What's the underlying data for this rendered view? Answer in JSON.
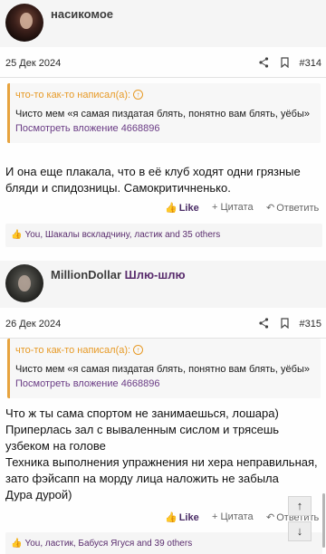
{
  "posts": [
    {
      "author": "насикомое",
      "author_link": "",
      "date": "25 Дек 2024",
      "number": "#314",
      "quote_header": "что-то как-то написал(а):",
      "quote_text": "Чисто мем «я самая пиздатая блять, понятно вам блять, уёбы»",
      "quote_link": "Посмотреть вложение 4668896",
      "body": [
        "И она еще плакала, что в её клуб ходят одни грязные",
        "бляди и спидозницы. Самокритичненько."
      ],
      "like_label": "Like",
      "quote_label": "+ Цитата",
      "reply_label": "Ответить",
      "likes_text": "You, Шакалы вскладчину, ластик and 35 others"
    },
    {
      "author": "MillionDollar",
      "author_link": "Шлю-шлю",
      "date": "26 Дек 2024",
      "number": "#315",
      "quote_header": "что-то как-то написал(а):",
      "quote_text": "Чисто мем «я самая пиздатая блять, понятно вам блять, уёбы»",
      "quote_link": "Посмотреть вложение 4668896",
      "body": [
        "Что ж ты сама спортом не занимаешься, лошара)",
        "Приперлась зал с вываленным сислом и трясешь",
        "узбеком на голове",
        "Техника выполнения упражнения ни хера неправильная,",
        "зато фэйсапп на морду лица наложить не забыла",
        "Дура дурой)"
      ],
      "like_label": "Like",
      "quote_label": "+ Цитата",
      "reply_label": "Ответить",
      "likes_text": "You, ластик, Бабуся Ягуся and 39 others"
    }
  ],
  "icons": {
    "share": "share-icon",
    "bookmark": "bookmark-icon",
    "like": "thumbs-up-icon",
    "reply": "reply-icon",
    "up": "arrow-up-icon",
    "down": "arrow-down-icon"
  },
  "colors": {
    "accent": "#e79a26",
    "link": "#5a2d6e"
  }
}
